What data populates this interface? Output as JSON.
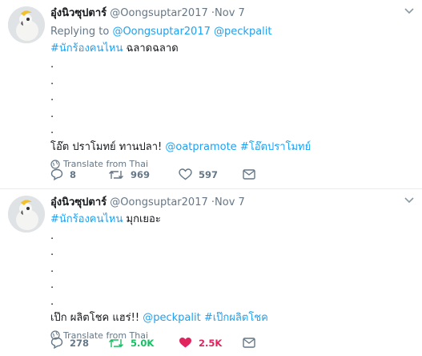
{
  "tweets": [
    {
      "author_name": "อุ๋งนิวซุปตาร์",
      "handle": "@Oongsuptar2017",
      "separator": "·",
      "date": "Nov 7",
      "replying_label": "Replying to",
      "replying_to": [
        "@Oongsuptar2017",
        "@peckpalit"
      ],
      "hashtag": "#นักร้องคนไหน",
      "line1_rest": " ฉลาดฉลาด",
      "dots": [
        ".",
        ".",
        ".",
        ".",
        "."
      ],
      "final_text": "โอ๊ต ปราโมทย์ ทานปลา! ",
      "final_mention": "@oatpramote",
      "final_hashtag": "#โอ๊ตปราโมทย์",
      "translate": "Translate from Thai",
      "replies": "8",
      "retweets": "969",
      "likes": "597"
    },
    {
      "author_name": "อุ๋งนิวซุปตาร์",
      "handle": "@Oongsuptar2017",
      "separator": "·",
      "date": "Nov 7",
      "hashtag": "#นักร้องคนไหน",
      "line1_rest": " มุกเยอะ",
      "dots": [
        ".",
        ".",
        ".",
        ".",
        "."
      ],
      "final_text": "เป๊ก ผลิตโชค แฮร่!! ",
      "final_mention": "@peckpalit",
      "final_hashtag": "#เป๊กผลิตโชค",
      "translate": "Translate from Thai",
      "replies": "278",
      "retweets": "5.0K",
      "likes": "2.5K"
    }
  ],
  "colors": {
    "link": "#1da1f2",
    "muted": "#657786",
    "retweet_active": "#17bf63",
    "like_active": "#e0245e"
  }
}
